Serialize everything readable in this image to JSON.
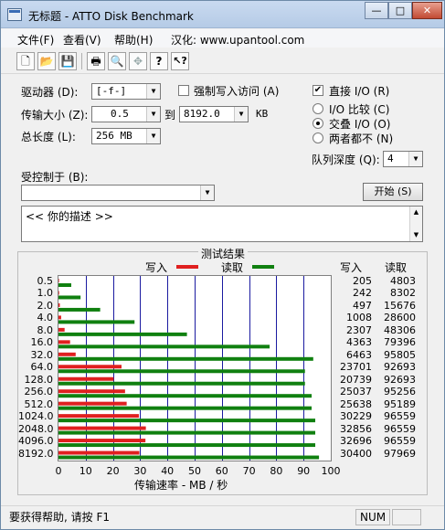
{
  "window": {
    "title": "无标题 - ATTO Disk Benchmark",
    "min_label": "—",
    "max_label": "□",
    "close_label": "✕"
  },
  "menu": [
    {
      "label": "文件(F)"
    },
    {
      "label": "查看(V)"
    },
    {
      "label": "帮助(H)"
    },
    {
      "label": "汉化: www.upantool.com"
    }
  ],
  "toolbar": [
    {
      "name": "new-file-icon",
      "glyph": "🗋"
    },
    {
      "name": "open-folder-icon",
      "glyph": "📂"
    },
    {
      "name": "save-icon",
      "glyph": "💾"
    },
    {
      "name": "print-icon",
      "glyph": "🖶"
    },
    {
      "name": "print-preview-icon",
      "glyph": "🔍"
    },
    {
      "name": "move-icon",
      "glyph": "✥"
    },
    {
      "name": "help-icon",
      "glyph": "?"
    },
    {
      "name": "context-help-icon",
      "glyph": "↖?"
    }
  ],
  "form": {
    "drive_label": "驱动器 (D):",
    "drive_value": "[-f-]",
    "force_write_label": "强制写入访问 (A)",
    "force_write_checked": false,
    "direct_io_label": "直接 I/O (R)",
    "direct_io_checked": true,
    "transfer_label": "传输大小 (Z):",
    "transfer_from": "0.5",
    "to_label": "到",
    "transfer_to": "8192.0",
    "kb_label": "KB",
    "total_label": "总长度 (L):",
    "total_value": "256 MB",
    "io_compare_label": "I/O 比较 (C)",
    "overlap_label": "交叠 I/O (O)",
    "neither_label": "两者都不 (N)",
    "io_selected": "overlap",
    "queue_label": "队列深度 (Q):",
    "queue_value": "4",
    "controlled_label": "受控制于 (B):",
    "controlled_value": "",
    "start_button": "开始 (S)",
    "description": "<<  你的描述   >>"
  },
  "results": {
    "group_title": "测试结果",
    "legend_write": "写入",
    "legend_read": "读取",
    "col_write": "写入",
    "col_read": "读取",
    "x_ticks": [
      "0",
      "10",
      "20",
      "30",
      "40",
      "50",
      "60",
      "70",
      "80",
      "90",
      "100"
    ],
    "x_axis_label": "传输速率 - MB / 秒"
  },
  "chart_data": {
    "type": "bar",
    "orientation": "horizontal",
    "title": "测试结果",
    "xlabel": "传输速率 - MB / 秒",
    "xlim": [
      0,
      100
    ],
    "categories": [
      "0.5",
      "1.0",
      "2.0",
      "4.0",
      "8.0",
      "16.0",
      "32.0",
      "64.0",
      "128.0",
      "256.0",
      "512.0",
      "1024.0",
      "2048.0",
      "4096.0",
      "8192.0"
    ],
    "series": [
      {
        "name": "写入",
        "color": "#e02020",
        "values": [
          0.2,
          0.24,
          0.49,
          0.98,
          2.25,
          4.26,
          6.31,
          23.15,
          20.25,
          24.45,
          25.04,
          29.52,
          32.09,
          31.93,
          29.69
        ],
        "labels": [
          "205",
          "242",
          "497",
          "1008",
          "2307",
          "4363",
          "6463",
          "23701",
          "20739",
          "25037",
          "25638",
          "30229",
          "32856",
          "32696",
          "30400"
        ]
      },
      {
        "name": "读取",
        "color": "#108010",
        "values": [
          4.69,
          8.11,
          15.31,
          27.93,
          47.18,
          77.54,
          93.56,
          90.52,
          90.52,
          92.97,
          92.96,
          94.3,
          94.3,
          94.3,
          95.67
        ],
        "labels": [
          "4803",
          "8302",
          "15676",
          "28600",
          "48306",
          "79396",
          "95805",
          "92693",
          "92693",
          "95256",
          "95189",
          "96559",
          "96559",
          "96559",
          "97969"
        ]
      }
    ],
    "grid": true
  },
  "statusbar": {
    "help_text": "要获得帮助, 请按 F1",
    "num_label": "NUM"
  }
}
